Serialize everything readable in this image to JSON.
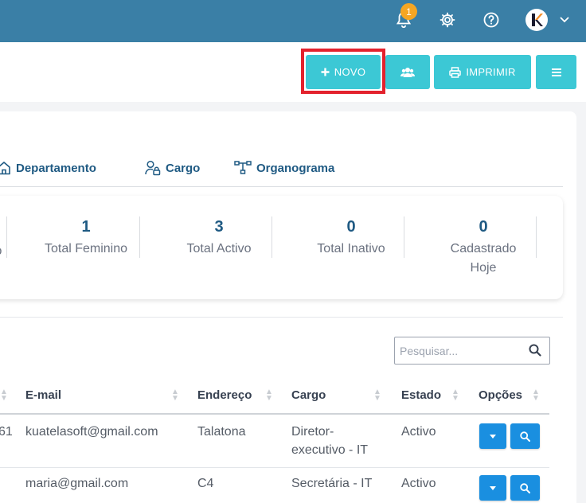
{
  "topbar": {
    "notification_count": "1",
    "avatar_letter": "K"
  },
  "toolbar": {
    "new_label": "NOVO",
    "print_label": "IMPRIMIR"
  },
  "tabs": [
    {
      "label": "Departamento",
      "icon": "home-icon"
    },
    {
      "label": "Cargo",
      "icon": "user-lock-icon"
    },
    {
      "label": "Organograma",
      "icon": "sitemap-icon"
    }
  ],
  "stats": {
    "partial_label": "o",
    "items": [
      {
        "value": "1",
        "label": "Total Feminino"
      },
      {
        "value": "3",
        "label": "Total Activo"
      },
      {
        "value": "0",
        "label": "Total Inativo"
      },
      {
        "value": "0",
        "label_line1": "Cadastrado",
        "label_line2": "Hoje"
      }
    ]
  },
  "search": {
    "placeholder": "Pesquisar..."
  },
  "table": {
    "headers": [
      "E-mail",
      "Endereço",
      "Cargo",
      "Estado",
      "Opções"
    ],
    "rows": [
      {
        "partial": "61",
        "email": "kuatelasoft@gmail.com",
        "address": "Talatona",
        "cargo_line1": "Diretor-",
        "cargo_line2": "executivo - IT",
        "estado": "Activo"
      },
      {
        "partial": "",
        "email": "maria@gmail.com",
        "address": "C4",
        "cargo_line1": "Secretária - IT",
        "cargo_line2": "",
        "estado": "Activo"
      }
    ]
  },
  "colors": {
    "topbar": "#3a7fa6",
    "accent": "#3cc8d5",
    "highlight": "#e3222d",
    "primary_text": "#1f5a83",
    "option_button": "#1a8fe0"
  }
}
